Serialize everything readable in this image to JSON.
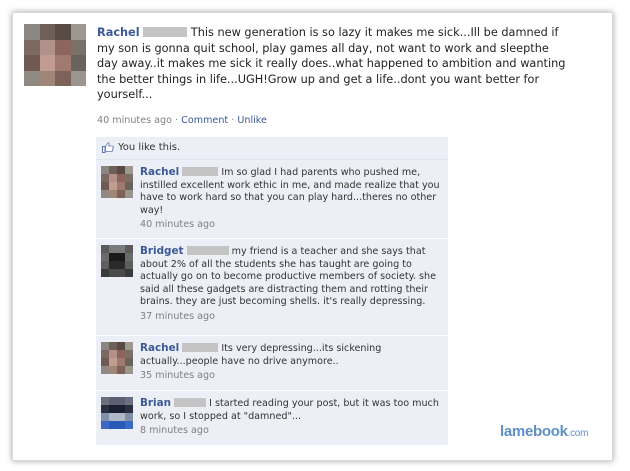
{
  "post": {
    "author": "Rachel",
    "text": "This new generation is so lazy it makes me sick...Ill be damned if my son is gonna quit school, play games all day, not want to work and sleepthe day away..it makes me sick it really does..what happened to ambition and wanting the better things in life...UGH!Grow up and get a life..dont you want better for yourself...",
    "time": "40 minutes ago",
    "comment_link": "Comment",
    "unlike_link": "Unlike",
    "separator": "·"
  },
  "likes": {
    "text": "You like this.",
    "icon": "thumbs-up-icon"
  },
  "comments": [
    {
      "author": "Rachel",
      "text": "Im so glad I had parents who pushed me, instilled excellent work ethic in me, and made realize that you have to work hard so that you can play hard...theres no other way!",
      "time": "40 minutes ago"
    },
    {
      "author": "Bridget",
      "text": "my friend is a teacher and she says that about 2% of all the students she has taught are going to actually go on to become productive members of society. she said all these gadgets are distracting them and rotting their brains. they are just becoming shells. it's really depressing.",
      "time": "37 minutes ago"
    },
    {
      "author": "Rachel",
      "text": "Its very depressing...its sickening actually...people have no drive anymore..",
      "time": "35 minutes ago"
    },
    {
      "author": "Brian",
      "text": "I started reading your post, but it was too much work, so I stopped at \"damned\"...",
      "time": "8 minutes ago"
    }
  ],
  "watermark": {
    "brand": "lamebook",
    "suffix": ".com"
  },
  "colors": {
    "link": "#3b5998",
    "comment_bg": "#eceff5",
    "watermark": "#5f8fc4"
  }
}
